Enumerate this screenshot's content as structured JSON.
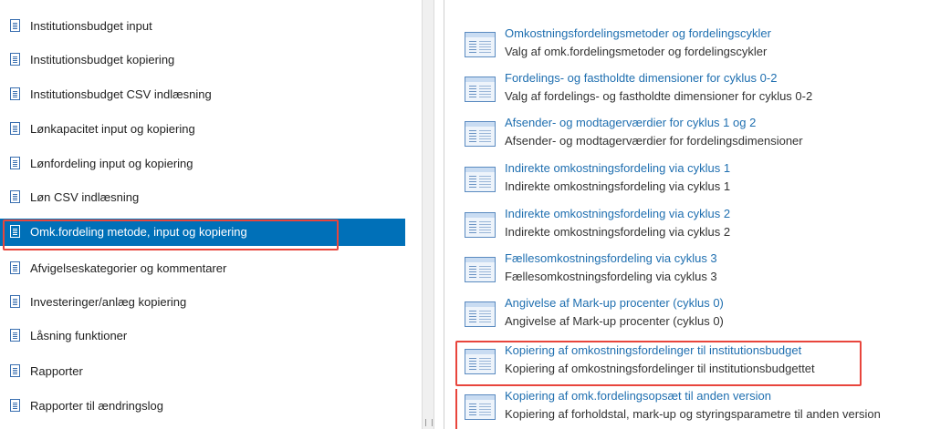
{
  "sidebar": {
    "items": [
      {
        "label": "Institutionsbudget input"
      },
      {
        "label": "Institutionsbudget kopiering"
      },
      {
        "label": "Institutionsbudget CSV indlæsning"
      },
      {
        "label": "Lønkapacitet input og kopiering"
      },
      {
        "label": "Lønfordeling input og kopiering"
      },
      {
        "label": "Løn CSV indlæsning"
      },
      {
        "label": "Omk.fordeling metode, input og kopiering"
      },
      {
        "label": "Afvigelseskategorier og kommentarer"
      },
      {
        "label": "Investeringer/anlæg kopiering"
      },
      {
        "label": "Låsning funktioner"
      },
      {
        "label": "Rapporter"
      },
      {
        "label": "Rapporter til ændringslog"
      }
    ],
    "active_index": 6
  },
  "content": {
    "cards": [
      {
        "title": "Omkostningsfordelingsmetoder og fordelingscykler",
        "desc": "Valg af omk.fordelingsmetoder og fordelingscykler"
      },
      {
        "title": "Fordelings- og fastholdte dimensioner for cyklus 0-2",
        "desc": "Valg af fordelings- og fastholdte dimensioner for cyklus 0-2"
      },
      {
        "title": "Afsender- og modtagerværdier for cyklus 1 og 2",
        "desc": "Afsender- og modtagerværdier for fordelingsdimensioner"
      },
      {
        "title": "Indirekte omkostningsfordeling via cyklus 1",
        "desc": "Indirekte omkostningsfordeling via cyklus 1"
      },
      {
        "title": "Indirekte omkostningsfordeling via cyklus 2",
        "desc": "Indirekte omkostningsfordeling via cyklus 2"
      },
      {
        "title": "Fællesomkostningsfordeling via cyklus 3",
        "desc": "Fællesomkostningsfordeling via cyklus 3"
      },
      {
        "title": "Angivelse af Mark-up procenter (cyklus 0)",
        "desc": "Angivelse af Mark-up procenter (cyklus 0)"
      },
      {
        "title": "Kopiering af omkostningsfordelinger til institutionsbudget",
        "desc": "Kopiering af omkostningsfordelinger til institutionsbudgettet"
      },
      {
        "title": "Kopiering af omk.fordelingsopsæt til anden version",
        "desc": "Kopiering af forholdstal, mark-up og styringsparametre til anden version"
      }
    ]
  },
  "colors": {
    "active_bg": "#0070b8",
    "link": "#1f6fb0",
    "highlight": "#e8453c"
  },
  "icons": {
    "nav": "document-icon",
    "card": "table-document-icon"
  }
}
